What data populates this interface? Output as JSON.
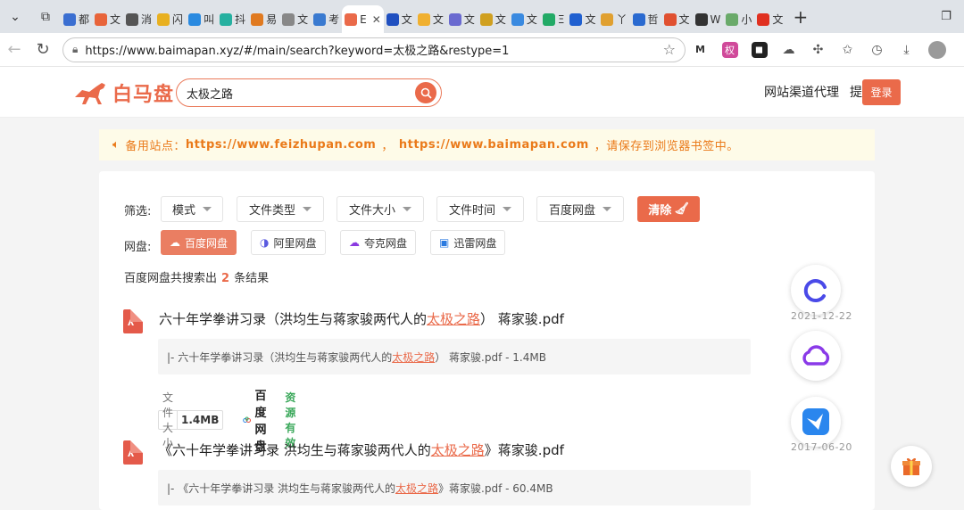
{
  "browser": {
    "tabs": [
      {
        "label": "都",
        "color": "#3b6fd1"
      },
      {
        "label": "文",
        "color": "#e8643a"
      },
      {
        "label": "消",
        "color": "#555555"
      },
      {
        "label": "闪",
        "color": "#e8b020"
      },
      {
        "label": "叫",
        "color": "#2a8ae0"
      },
      {
        "label": "抖",
        "color": "#26b0a0"
      },
      {
        "label": "易",
        "color": "#e07a20"
      },
      {
        "label": "文",
        "color": "#888888"
      },
      {
        "label": "考",
        "color": "#3a7ad0"
      }
    ],
    "active_tab": {
      "label": "E"
    },
    "tabs_right": [
      {
        "label": "文",
        "color": "#2050c0"
      },
      {
        "label": "文",
        "color": "#f0b030"
      },
      {
        "label": "文",
        "color": "#6a6ad0"
      },
      {
        "label": "文",
        "color": "#d0a020"
      },
      {
        "label": "文",
        "color": "#3a8ae0"
      },
      {
        "label": "Ξ",
        "color": "#22aa66"
      },
      {
        "label": "文",
        "color": "#2060d0"
      },
      {
        "label": "丫",
        "color": "#e0a030"
      },
      {
        "label": "哲",
        "color": "#2a6ad0"
      },
      {
        "label": "文",
        "color": "#e05030"
      },
      {
        "label": "W",
        "color": "#333333"
      },
      {
        "label": "小",
        "color": "#6aaa6a"
      },
      {
        "label": "文",
        "color": "#e03020"
      }
    ],
    "url": "https://www.baimapan.xyz/#/main/search?keyword=太极之路&restype=1",
    "ext_icons": [
      "ext-ai-icon",
      "ext-mark-icon",
      "ext-game-icon",
      "ext-cloud-icon",
      "extensions-icon",
      "favorites-icon",
      "history-icon",
      "downloads-icon"
    ]
  },
  "site": {
    "logo_text": "白马盘",
    "search_value": "太极之路",
    "nav_links": [
      "网站渠道代理",
      "提交资源"
    ],
    "login_label": "登录",
    "notice": {
      "prefix": "备用站点：",
      "url1": "https://www.feizhupan.com",
      "sep": "，",
      "url2": "https://www.baimapan.com",
      "suffix": "，请保存到浏览器书签中。"
    }
  },
  "filters": {
    "label": "筛选:",
    "dropdowns": [
      "模式",
      "文件类型",
      "文件大小",
      "文件时间",
      "百度网盘"
    ],
    "clear_label": "清除"
  },
  "disks": {
    "label": "网盘:",
    "items": [
      "百度网盘",
      "阿里网盘",
      "夸克网盘",
      "迅雷网盘"
    ],
    "active_index": 0
  },
  "results_summary": {
    "prefix": "百度网盘共搜索出",
    "count": "2",
    "suffix": "条结果"
  },
  "results": [
    {
      "title_pre": "六十年学拳讲习录（洪均生与蒋家骏两代人的",
      "title_hl": "太极之路",
      "title_post": "） 蒋家骏.pdf",
      "snippet_pre": "|- 六十年学拳讲习录（洪均生与蒋家骏两代人的",
      "snippet_hl": "太极之路",
      "snippet_post": "） 蒋家骏.pdf - 1.4MB",
      "size_label": "文件大小",
      "size": "1.4MB",
      "disk": "百度网盘",
      "status": "资源有效"
    },
    {
      "title_pre": "《六十年学拳讲习录 洪均生与蒋家骏两代人的",
      "title_hl": "太极之路",
      "title_post": "》蒋家骏.pdf",
      "snippet_pre": "|- 《六十年学拳讲习录 洪均生与蒋家骏两代人的",
      "snippet_hl": "太极之路",
      "snippet_post": "》蒋家骏.pdf - 60.4MB"
    }
  ],
  "float_dates": [
    "2021-12-22",
    "2017-06-20"
  ]
}
